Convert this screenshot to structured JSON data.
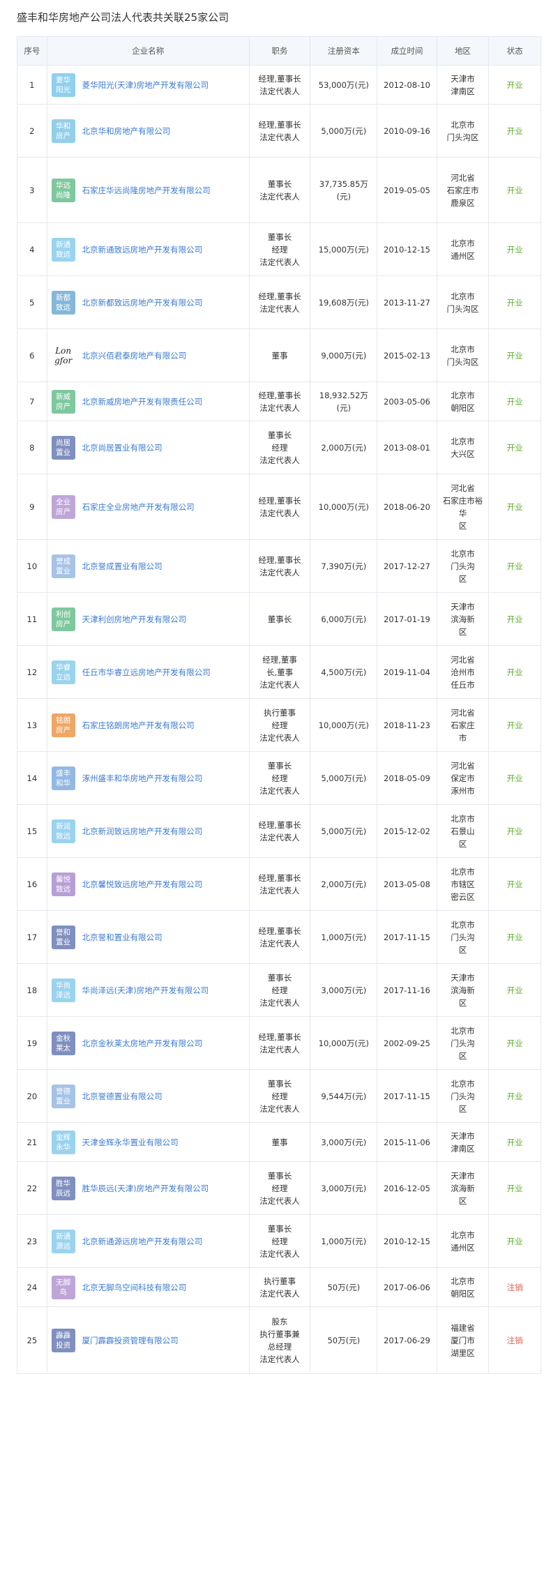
{
  "title": "盛丰和华房地产公司法人代表共关联25家公司",
  "colors": {
    "header_bg": "#f4f8fc",
    "link": "#3a7ad5",
    "open": "#5fb12f",
    "cancel": "#e05a4c",
    "border": "#e4e8ee"
  },
  "headers": {
    "index": "序号",
    "company": "企业名称",
    "position": "职务",
    "capital": "注册资本",
    "established": "成立时间",
    "region": "地区",
    "status": "状态"
  },
  "rows": [
    {
      "index": "1",
      "logo": "菱华\n阳光",
      "logo_color": "#8fd0ef",
      "name": "菱华阳光(天津)房地产开发有限公司",
      "position": "经理,董事长\n法定代表人",
      "capital": "53,000万(元)",
      "date": "2012-08-10",
      "region": "天津市\n津南区",
      "status": "开业",
      "status_type": "open"
    },
    {
      "index": "2",
      "logo": "华和\n房产",
      "logo_color": "#93cfe9",
      "name": "北京华和房地产有限公司",
      "position": "经理,董事长\n法定代表人",
      "capital": "5,000万(元)",
      "date": "2010-09-16",
      "region": "北京市\n门头沟区",
      "status": "开业",
      "status_type": "open"
    },
    {
      "index": "3",
      "logo": "华远\n尚隆",
      "logo_color": "#7fc89e",
      "name": "石家庄华远尚隆房地产开发有限公司",
      "position": "董事长\n法定代表人",
      "capital": "37,735.85万\n(元)",
      "date": "2019-05-05",
      "region": "河北省\n石家庄市\n鹿泉区",
      "status": "开业",
      "status_type": "open"
    },
    {
      "index": "4",
      "logo": "新通\n致远",
      "logo_color": "#9ad3ef",
      "name": "北京新通致远房地产开发有限公司",
      "position": "董事长\n经理\n法定代表人",
      "capital": "15,000万(元)",
      "date": "2010-12-15",
      "region": "北京市\n通州区",
      "status": "开业",
      "status_type": "open"
    },
    {
      "index": "5",
      "logo": "新都\n致远",
      "logo_color": "#84b7d9",
      "name": "北京新都致远房地产开发有限公司",
      "position": "经理,董事长\n法定代表人",
      "capital": "19,608万(元)",
      "date": "2013-11-27",
      "region": "北京市\n门头沟区",
      "status": "开业",
      "status_type": "open"
    },
    {
      "index": "6",
      "logo": "Longfor",
      "logo_color": "#ffffff",
      "name": "北京兴佰君泰房地产有限公司",
      "position": "董事",
      "capital": "9,000万(元)",
      "date": "2015-02-13",
      "region": "北京市\n门头沟区",
      "status": "开业",
      "status_type": "open"
    },
    {
      "index": "7",
      "logo": "新威\n房产",
      "logo_color": "#7fc89e",
      "name": "北京新威房地产开发有限责任公司",
      "position": "经理,董事长\n法定代表人",
      "capital": "18,932.52万\n(元)",
      "date": "2003-05-06",
      "region": "北京市\n朝阳区",
      "status": "开业",
      "status_type": "open"
    },
    {
      "index": "8",
      "logo": "尚居\n置业",
      "logo_color": "#7f8fbf",
      "name": "北京尚居置业有限公司",
      "position": "董事长\n经理\n法定代表人",
      "capital": "2,000万(元)",
      "date": "2013-08-01",
      "region": "北京市\n大兴区",
      "status": "开业",
      "status_type": "open"
    },
    {
      "index": "9",
      "logo": "全业\n房产",
      "logo_color": "#bfa6d9",
      "name": "石家庄全业房地产开发有限公司",
      "position": "经理,董事长\n法定代表人",
      "capital": "10,000万(元)",
      "date": "2018-06-20",
      "region": "河北省\n石家庄市裕华\n区",
      "status": "开业",
      "status_type": "open"
    },
    {
      "index": "10",
      "logo": "誉成\n置业",
      "logo_color": "#a6c3e6",
      "name": "北京誉成置业有限公司",
      "position": "经理,董事长\n法定代表人",
      "capital": "7,390万(元)",
      "date": "2017-12-27",
      "region": "北京市\n门头沟\n区",
      "status": "开业",
      "status_type": "open"
    },
    {
      "index": "11",
      "logo": "利创\n房产",
      "logo_color": "#7fc89e",
      "name": "天津利创房地产开发有限公司",
      "position": "董事长",
      "capital": "6,000万(元)",
      "date": "2017-01-19",
      "region": "天津市\n滨海新\n区",
      "status": "开业",
      "status_type": "open"
    },
    {
      "index": "12",
      "logo": "华睿\n立远",
      "logo_color": "#9ad3ef",
      "name": "任丘市华睿立远房地产开发有限公司",
      "position": "经理,董事\n长,董事\n法定代表人",
      "capital": "4,500万(元)",
      "date": "2019-11-04",
      "region": "河北省\n沧州市\n任丘市",
      "status": "开业",
      "status_type": "open"
    },
    {
      "index": "13",
      "logo": "铭朗\n房产",
      "logo_color": "#f0a664",
      "name": "石家庄铭朗房地产开发有限公司",
      "position": "执行董事\n经理\n法定代表人",
      "capital": "10,000万(元)",
      "date": "2018-11-23",
      "region": "河北省\n石家庄\n市",
      "status": "开业",
      "status_type": "open"
    },
    {
      "index": "14",
      "logo": "盛丰\n和华",
      "logo_color": "#93b9e3",
      "name": "涿州盛丰和华房地产开发有限公司",
      "position": "董事长\n经理\n法定代表人",
      "capital": "5,000万(元)",
      "date": "2018-05-09",
      "region": "河北省\n保定市\n涿州市",
      "status": "开业",
      "status_type": "open"
    },
    {
      "index": "15",
      "logo": "新润\n致远",
      "logo_color": "#9ad3ef",
      "name": "北京新润致远房地产开发有限公司",
      "position": "经理,董事长\n法定代表人",
      "capital": "5,000万(元)",
      "date": "2015-12-02",
      "region": "北京市\n石景山\n区",
      "status": "开业",
      "status_type": "open"
    },
    {
      "index": "16",
      "logo": "馨悦\n致远",
      "logo_color": "#b79fd6",
      "name": "北京馨悦致远房地产开发有限公司",
      "position": "经理,董事长\n法定代表人",
      "capital": "2,000万(元)",
      "date": "2013-05-08",
      "region": "北京市\n市辖区\n密云区",
      "status": "开业",
      "status_type": "open"
    },
    {
      "index": "17",
      "logo": "誉和\n置业",
      "logo_color": "#7f8fbf",
      "name": "北京誉和置业有限公司",
      "position": "经理,董事长\n法定代表人",
      "capital": "1,000万(元)",
      "date": "2017-11-15",
      "region": "北京市\n门头沟\n区",
      "status": "开业",
      "status_type": "open"
    },
    {
      "index": "18",
      "logo": "华尚\n泽远",
      "logo_color": "#9ad3ef",
      "name": "华尚泽远(天津)房地产开发有限公司",
      "position": "董事长\n经理\n法定代表人",
      "capital": "3,000万(元)",
      "date": "2017-11-16",
      "region": "天津市\n滨海新\n区",
      "status": "开业",
      "status_type": "open"
    },
    {
      "index": "19",
      "logo": "金秋\n莱太",
      "logo_color": "#7f8fbf",
      "name": "北京金秋莱太房地产开发有限公司",
      "position": "经理,董事长\n法定代表人",
      "capital": "10,000万(元)",
      "date": "2002-09-25",
      "region": "北京市\n门头沟\n区",
      "status": "开业",
      "status_type": "open"
    },
    {
      "index": "20",
      "logo": "誉德\n置业",
      "logo_color": "#a6c3e6",
      "name": "北京誉德置业有限公司",
      "position": "董事长\n经理\n法定代表人",
      "capital": "9,544万(元)",
      "date": "2017-11-15",
      "region": "北京市\n门头沟\n区",
      "status": "开业",
      "status_type": "open"
    },
    {
      "index": "21",
      "logo": "金辉\n永华",
      "logo_color": "#9ad3ef",
      "name": "天津金辉永华置业有限公司",
      "position": "董事",
      "capital": "3,000万(元)",
      "date": "2015-11-06",
      "region": "天津市\n津南区",
      "status": "开业",
      "status_type": "open"
    },
    {
      "index": "22",
      "logo": "胜华\n辰远",
      "logo_color": "#7f8fbf",
      "name": "胜华辰远(天津)房地产开发有限公司",
      "position": "董事长\n经理\n法定代表人",
      "capital": "3,000万(元)",
      "date": "2016-12-05",
      "region": "天津市\n滨海新\n区",
      "status": "开业",
      "status_type": "open"
    },
    {
      "index": "23",
      "logo": "新通\n源远",
      "logo_color": "#9ad3ef",
      "name": "北京新通源远房地产开发有限公司",
      "position": "董事长\n经理\n法定代表人",
      "capital": "1,000万(元)",
      "date": "2010-12-15",
      "region": "北京市\n通州区",
      "status": "开业",
      "status_type": "open"
    },
    {
      "index": "24",
      "logo": "无脚\n鸟",
      "logo_color": "#bfa6d9",
      "name": "北京无脚鸟空间科技有限公司",
      "position": "执行董事\n法定代表人",
      "capital": "50万(元)",
      "date": "2017-06-06",
      "region": "北京市\n朝阳区",
      "status": "注销",
      "status_type": "cancel"
    },
    {
      "index": "25",
      "logo": "霹霹\n投资",
      "logo_color": "#7f8fbf",
      "name": "厦门霹霹投资管理有限公司",
      "position": "股东\n执行董事兼\n总经理\n法定代表人",
      "capital": "50万(元)",
      "date": "2017-06-29",
      "region": "福建省\n厦门市\n湖里区",
      "status": "注销",
      "status_type": "cancel"
    }
  ]
}
